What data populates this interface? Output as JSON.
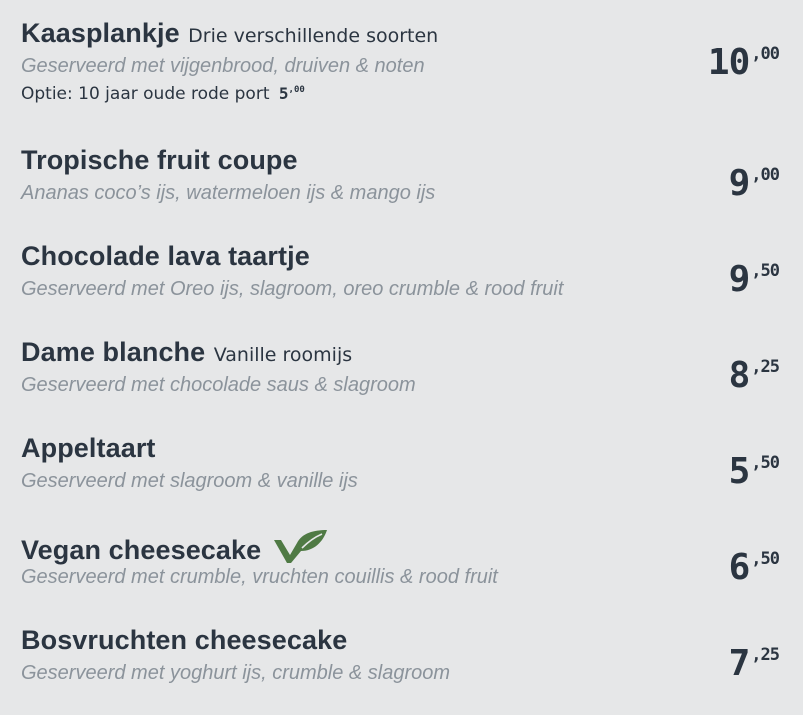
{
  "items": [
    {
      "name": "Kaasplankje",
      "subtitle": "Drie verschillende soorten",
      "description": "Geserveerd met vijgenbrood, druiven & noten",
      "option_label": "Optie: 10 jaar oude rode port",
      "option_price_main": "5",
      "option_price_cents": ",00",
      "price_main": "10",
      "price_cents": ",00"
    },
    {
      "name": "Tropische fruit coupe",
      "description": "Ananas coco’s ijs, watermeloen ijs & mango ijs",
      "price_main": "9",
      "price_cents": ",00"
    },
    {
      "name": "Chocolade lava taartje",
      "description": "Geserveerd met Oreo ijs, slagroom, oreo crumble & rood fruit",
      "price_main": "9",
      "price_cents": ",50"
    },
    {
      "name": "Dame blanche",
      "subtitle": "Vanille roomijs",
      "description": "Geserveerd met chocolade saus & slagroom",
      "price_main": "8",
      "price_cents": ",25"
    },
    {
      "name": "Appeltaart",
      "description": "Geserveerd met slagroom & vanille ijs",
      "price_main": "5",
      "price_cents": ",50"
    },
    {
      "name": "Vegan cheesecake",
      "icon": "vegan-leaf-icon",
      "description": "Geserveerd met crumble, vruchten couillis & rood fruit",
      "price_main": "6",
      "price_cents": ",50"
    },
    {
      "name": "Bosvruchten cheesecake",
      "description": "Geserveerd met yoghurt ijs, crumble & slagroom",
      "price_main": "7",
      "price_cents": ",25"
    }
  ],
  "colors": {
    "background": "#e6e7e8",
    "text": "#2b3541",
    "description": "#8b939b",
    "vegan_leaf": "#4f7a44"
  }
}
